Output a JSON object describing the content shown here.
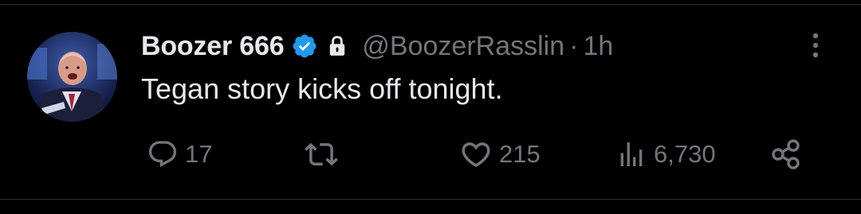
{
  "tweet": {
    "author": {
      "display_name": "Boozer 666",
      "handle": "@BoozerRasslin",
      "verified_icon": "verified-badge-icon",
      "protected_icon": "lock-icon"
    },
    "separator": "·",
    "time": "1h",
    "text": "Tegan story kicks off tonight.",
    "actions": {
      "reply_count": "17",
      "retweet_count": "",
      "like_count": "215",
      "views_count": "6,730"
    }
  },
  "colors": {
    "background": "#000000",
    "primary_text": "#e7e9ea",
    "secondary_text": "#71767b",
    "verified_blue": "#1d9bf0",
    "divider": "#2f3336"
  }
}
